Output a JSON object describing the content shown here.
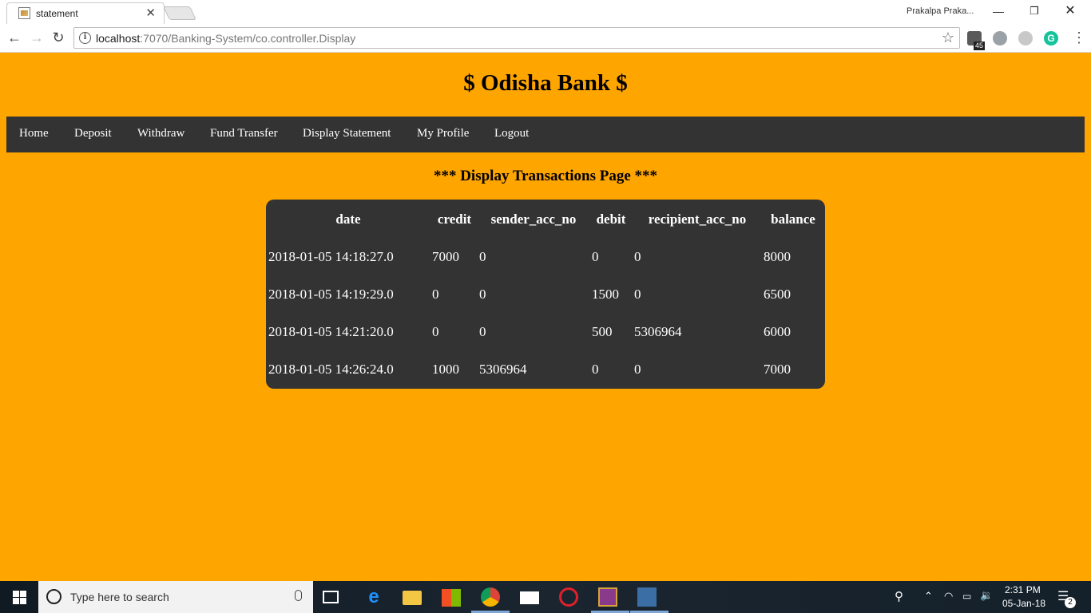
{
  "browser": {
    "tab_title": "statement",
    "profile_name": "Prakalpa Praka...",
    "url_host": "localhost",
    "url_rest": ":7070/Banking-System/co.controller.Display",
    "extension_badge": "45"
  },
  "page": {
    "site_title": "$ Odisha Bank $",
    "nav": [
      "Home",
      "Deposit",
      "Withdraw",
      "Fund Transfer",
      "Display Statement",
      "My Profile",
      "Logout"
    ],
    "heading": "*** Display Transactions Page ***",
    "table": {
      "columns": [
        "date",
        "credit",
        "sender_acc_no",
        "debit",
        "recipient_acc_no",
        "balance"
      ],
      "rows": [
        [
          "2018-01-05 14:18:27.0",
          "7000",
          "0",
          "0",
          "0",
          "8000"
        ],
        [
          "2018-01-05 14:19:29.0",
          "0",
          "0",
          "1500",
          "0",
          "6500"
        ],
        [
          "2018-01-05 14:21:20.0",
          "0",
          "0",
          "500",
          "5306964",
          "6000"
        ],
        [
          "2018-01-05 14:26:24.0",
          "1000",
          "5306964",
          "0",
          "0",
          "7000"
        ]
      ]
    },
    "colors": {
      "background": "#ffa500",
      "navbar": "#333333",
      "table": "#333333"
    }
  },
  "taskbar": {
    "search_placeholder": "Type here to search",
    "time": "2:31 PM",
    "date": "05-Jan-18",
    "notification_count": "2",
    "pinned_icons": [
      "task-view-icon",
      "edge-icon",
      "file-explorer-icon",
      "store-icon",
      "chrome-icon",
      "mail-icon",
      "app-icon",
      "wamp-icon",
      "mysql-workbench-icon"
    ]
  }
}
